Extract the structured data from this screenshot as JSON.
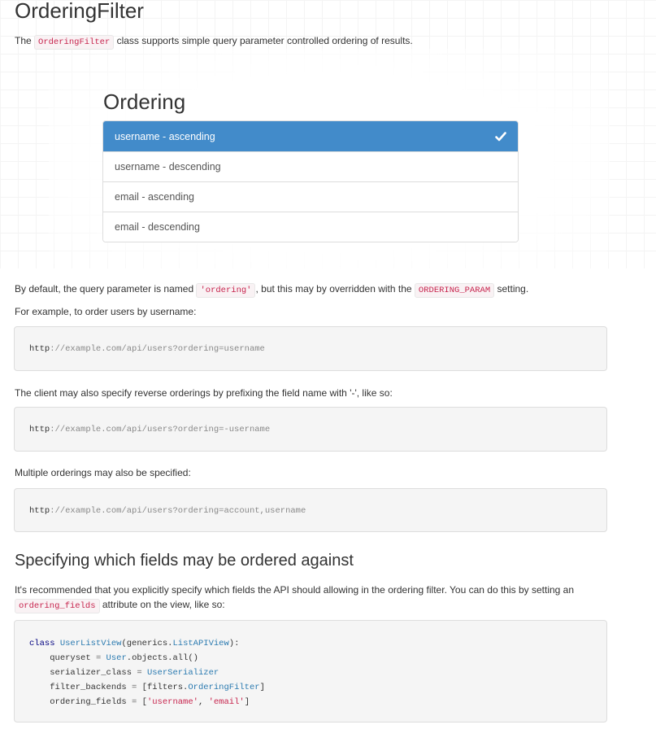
{
  "title": "OrderingFilter",
  "intro": {
    "prefix": "The",
    "code": "OrderingFilter",
    "suffix": "class supports simple query parameter controlled ordering of results."
  },
  "ordering_widget": {
    "heading": "Ordering",
    "items": [
      {
        "label": "username - ascending",
        "active": true
      },
      {
        "label": "username - descending",
        "active": false
      },
      {
        "label": "email - ascending",
        "active": false
      },
      {
        "label": "email - descending",
        "active": false
      }
    ]
  },
  "default_para": {
    "t1": "By default, the query parameter is named",
    "c1": "'ordering'",
    "t2": ", but this may by overridden with the",
    "c2": "ORDERING_PARAM",
    "t3": "setting."
  },
  "example_para": "For example, to order users by username:",
  "code1": {
    "scheme": "http",
    "rest": "://example.com/api/users?ordering=username"
  },
  "reverse_para": "The client may also specify reverse orderings by prefixing the field name with '-', like so:",
  "code2": {
    "scheme": "http",
    "rest": "://example.com/api/users?ordering=-username"
  },
  "multiple_para": "Multiple orderings may also be specified:",
  "code3": {
    "scheme": "http",
    "rest": "://example.com/api/users?ordering=account,username"
  },
  "section_heading": "Specifying which fields may be ordered against",
  "recommend_para": {
    "t1": "It's recommended that you explicitly specify which fields the API should allowing in the ordering filter. You can do this by setting an",
    "c1": "ordering_fields",
    "t2": "attribute on the view, like so:"
  },
  "code4": {
    "l1_kw": "class",
    "l1_cls": "UserListView",
    "l1_mid": "(generics.",
    "l1_base": "ListAPIView",
    "l1_end": "):",
    "l2_a": "queryset",
    "l2_eq": " = ",
    "l2_cls": "User",
    "l2_end": ".objects.all()",
    "l3_a": "serializer_class",
    "l3_eq": " = ",
    "l3_cls": "UserSerializer",
    "l4_a": "filter_backends",
    "l4_eq": " = ",
    "l4_b": "[filters.",
    "l4_cls": "OrderingFilter",
    "l4_end": "]",
    "l5_a": "ordering_fields",
    "l5_eq": " = ",
    "l5_b": "[",
    "l5_s1": "'username'",
    "l5_c": ", ",
    "l5_s2": "'email'",
    "l5_end": "]"
  }
}
